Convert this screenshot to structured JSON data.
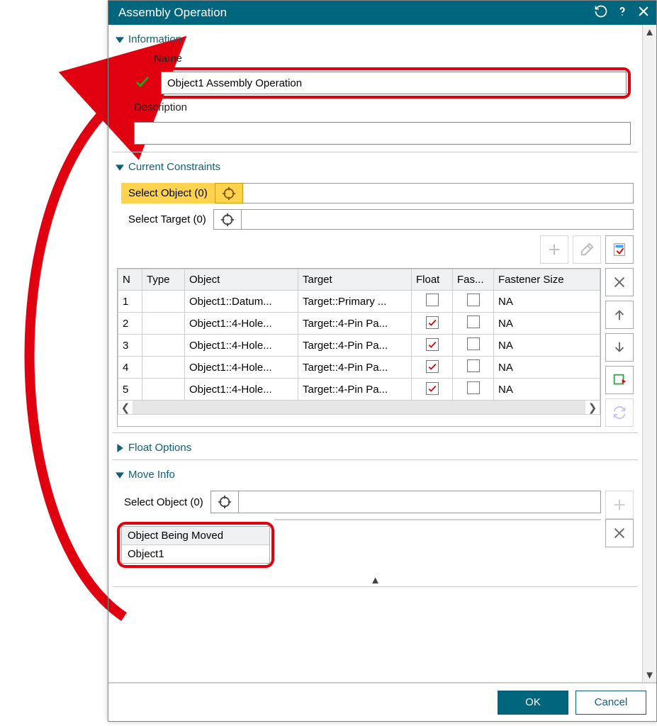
{
  "titlebar": {
    "title": "Assembly Operation"
  },
  "sections": {
    "information": "Information",
    "current_constraints": "Current Constraints",
    "float_options": "Float Options",
    "move_info": "Move Info"
  },
  "info": {
    "name_label": "Name",
    "name_value": "Object1 Assembly Operation",
    "description_label": "Description",
    "description_value": ""
  },
  "constraints": {
    "select_object_label": "Select Object (0)",
    "select_target_label": "Select Target (0)",
    "columns": {
      "n": "N",
      "type": "Type",
      "object": "Object",
      "target": "Target",
      "float": "Float",
      "fastener": "Fas...",
      "fastener_size": "Fastener Size"
    },
    "rows": [
      {
        "n": "1",
        "type": "",
        "object": "Object1::Datum...",
        "target": "Target::Primary ...",
        "float": false,
        "fastener": false,
        "fastener_size": "NA"
      },
      {
        "n": "2",
        "type": "",
        "object": "Object1::4-Hole...",
        "target": "Target::4-Pin Pa...",
        "float": true,
        "fastener": false,
        "fastener_size": "NA"
      },
      {
        "n": "3",
        "type": "",
        "object": "Object1::4-Hole...",
        "target": "Target::4-Pin Pa...",
        "float": true,
        "fastener": false,
        "fastener_size": "NA"
      },
      {
        "n": "4",
        "type": "",
        "object": "Object1::4-Hole...",
        "target": "Target::4-Pin Pa...",
        "float": true,
        "fastener": false,
        "fastener_size": "NA"
      },
      {
        "n": "5",
        "type": "",
        "object": "Object1::4-Hole...",
        "target": "Target::4-Pin Pa...",
        "float": true,
        "fastener": false,
        "fastener_size": "NA"
      }
    ]
  },
  "move": {
    "select_object_label": "Select Object (0)",
    "object_being_moved_header": "Object Being Moved",
    "object_being_moved_value": "Object1"
  },
  "footer": {
    "ok": "OK",
    "cancel": "Cancel"
  }
}
